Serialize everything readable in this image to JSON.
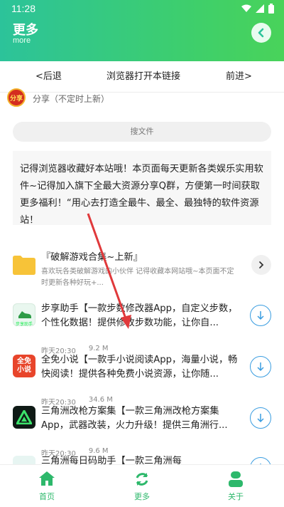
{
  "status": {
    "time": "11:28"
  },
  "header": {
    "title": "更多",
    "subtitle": "more"
  },
  "nav": {
    "back": "<后退",
    "open_browser": "浏览器打开本链接",
    "forward": "前进>"
  },
  "share": {
    "logo_text": "分享",
    "label": "分享（不定时上新）"
  },
  "search": {
    "placeholder": "搜文件"
  },
  "notice": {
    "text": "记得浏览器收藏好本站哦！本页面每天更新各类娱乐实用软件~记得加入旗下全最大资源分享Q群，方便第一时间获取更多福利！“用心去打造全最牛、最全、最独特的软件资源站！"
  },
  "folder": {
    "name": "『破解游戏合集~上新』",
    "desc": "喜欢玩各类破解游戏的小伙伴 记得收藏本网站哦~本页面不定时更新各种好玩+..."
  },
  "items": [
    {
      "name": "步享助手【一款步数修改器App，自定义步数，个性化数据！提供修改步数功能，让你自...",
      "icon_text": "步享助手",
      "date": "昨天20:30",
      "size": "9.2 M"
    },
    {
      "name": "全免小说【一款手小说阅读App，海量小说，畅快阅读！提供各种免费小说资源，让你随...",
      "icon_text": "全免小说",
      "date": "昨天20:30",
      "size": "34.6 M"
    },
    {
      "name": "三角洲改枪方案集【一款三角洲改枪方案集App，武器改装，火力升级！提供三角洲行...",
      "icon_text": "",
      "date": "昨天20:30",
      "size": "9.6 M"
    },
    {
      "name": "三角洲每日码助手【一款三角洲每",
      "icon_text": "",
      "date": "",
      "size": ""
    }
  ],
  "tabs": [
    {
      "label": "首页"
    },
    {
      "label": "更多"
    },
    {
      "label": "关于"
    }
  ],
  "colors": {
    "accent": "#2db86b",
    "download": "#3a9de0",
    "annotation_arrow": "#e0393b"
  }
}
